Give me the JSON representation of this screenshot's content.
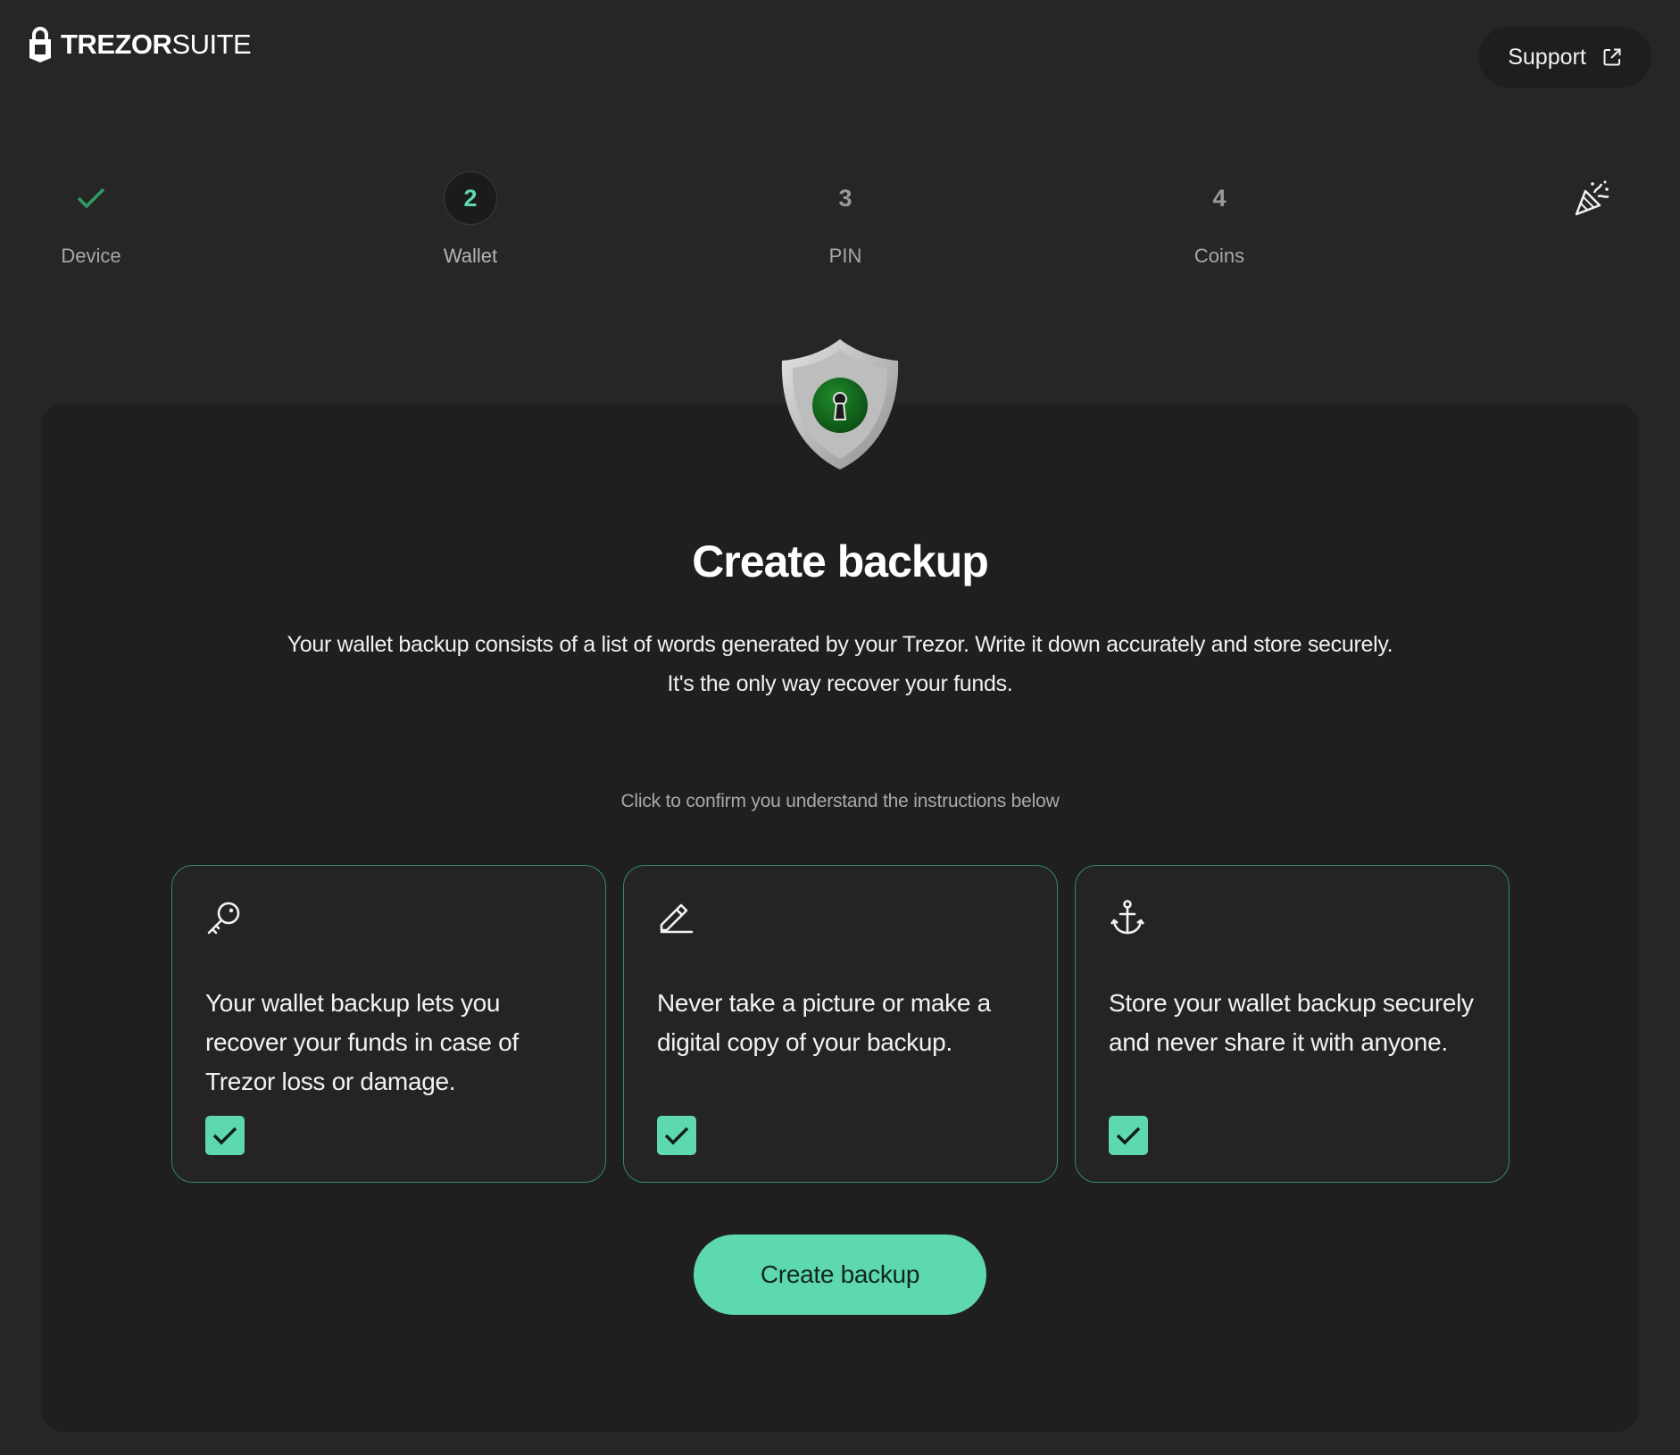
{
  "header": {
    "logo_bold": "TREZOR",
    "logo_light": "SUITE",
    "support_label": "Support"
  },
  "steps": [
    {
      "label": "Device",
      "state": "done"
    },
    {
      "number": "2",
      "label": "Wallet",
      "state": "active"
    },
    {
      "number": "3",
      "label": "PIN",
      "state": "pending"
    },
    {
      "number": "4",
      "label": "Coins",
      "state": "pending"
    }
  ],
  "main": {
    "title": "Create backup",
    "description_line1": "Your wallet backup consists of a list of words generated by your Trezor. Write it down accurately and store securely.",
    "description_line2": "It's the only way recover your funds.",
    "hint": "Click to confirm you understand the instructions below",
    "tiles": [
      {
        "icon": "key-icon",
        "text": "Your wallet backup lets you recover your funds in case of Trezor loss or damage.",
        "checked": true
      },
      {
        "icon": "pencil-icon",
        "text": "Never take a picture or make a digital copy of your backup.",
        "checked": true
      },
      {
        "icon": "anchor-icon",
        "text": "Store your wallet backup securely and never share it with anyone.",
        "checked": true
      }
    ],
    "cta_label": "Create backup"
  },
  "colors": {
    "accent": "#5ed8ae",
    "background": "#262626",
    "card": "#1f1f1f",
    "tile_border": "#2e8a6c"
  }
}
